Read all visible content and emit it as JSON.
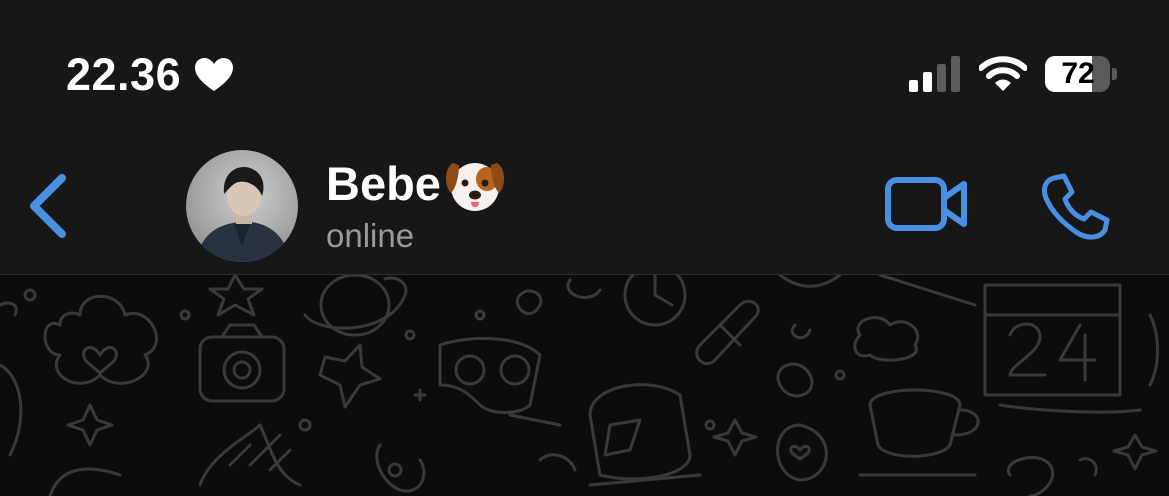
{
  "status_bar": {
    "time": "22.36",
    "focus_icon": "heart-icon",
    "signal_icon": "cellular-signal-icon",
    "wifi_icon": "wifi-icon",
    "battery_level": "72",
    "battery_fraction": 0.72
  },
  "header": {
    "back_icon": "chevron-left-icon",
    "contact_name": "Bebe",
    "contact_emoji": "dog-face-emoji",
    "contact_status": "online",
    "video_call_icon": "video-camera-icon",
    "voice_call_icon": "phone-icon",
    "accent_color": "#4a90e2"
  },
  "chat": {
    "wallpaper": "doodle-pattern",
    "wallpaper_color": "#0c0c0c",
    "doodle_color": "#3a3a3a"
  }
}
